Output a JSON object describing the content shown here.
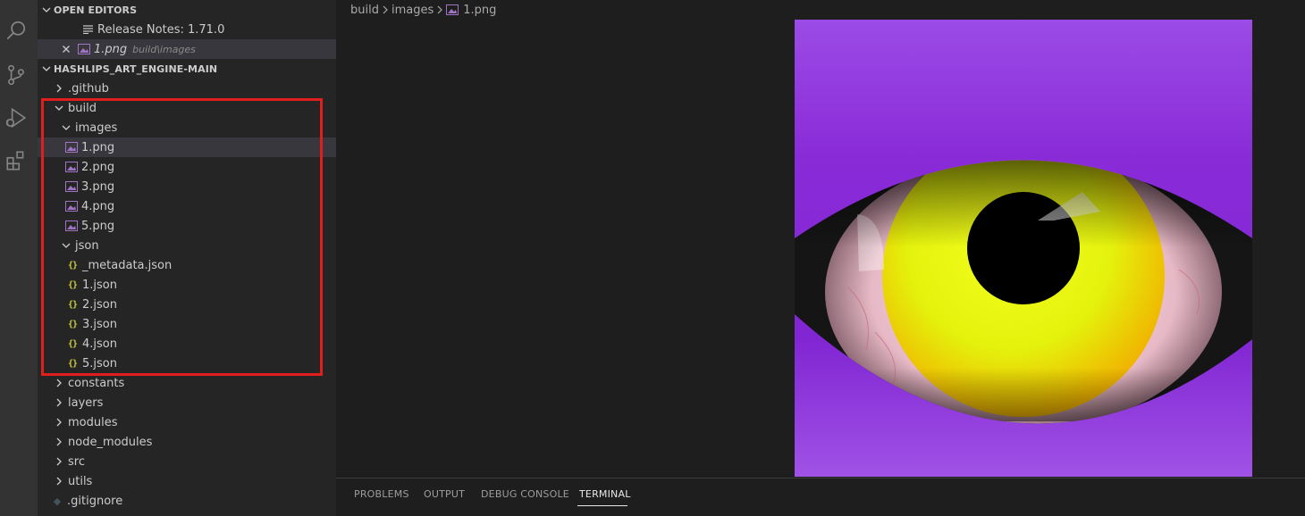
{
  "activity_bar": {
    "icons": [
      "search-icon",
      "source-control-icon",
      "run-debug-icon",
      "extensions-icon"
    ]
  },
  "sidebar": {
    "open_editors": {
      "title": "OPEN EDITORS",
      "items": [
        {
          "label": "Release Notes: 1.71.0"
        },
        {
          "label": "1.png",
          "path": "build\\images"
        }
      ]
    },
    "explorer": {
      "title": "HASHLIPS_ART_ENGINE-MAIN",
      "items": [
        {
          "label": ".github"
        },
        {
          "label": "build"
        },
        {
          "label": "images"
        },
        {
          "label": "1.png"
        },
        {
          "label": "2.png"
        },
        {
          "label": "3.png"
        },
        {
          "label": "4.png"
        },
        {
          "label": "5.png"
        },
        {
          "label": "json"
        },
        {
          "label": "_metadata.json"
        },
        {
          "label": "1.json"
        },
        {
          "label": "2.json"
        },
        {
          "label": "3.json"
        },
        {
          "label": "4.json"
        },
        {
          "label": "5.json"
        },
        {
          "label": "constants"
        },
        {
          "label": "layers"
        },
        {
          "label": "modules"
        },
        {
          "label": "node_modules"
        },
        {
          "label": "src"
        },
        {
          "label": "utils"
        },
        {
          "label": ".gitignore"
        }
      ]
    }
  },
  "editor": {
    "breadcrumb": [
      "build",
      "images",
      "1.png"
    ]
  },
  "panel": {
    "tabs": [
      "PROBLEMS",
      "OUTPUT",
      "DEBUG CONSOLE",
      "TERMINAL"
    ],
    "active_tab": "TERMINAL"
  },
  "colors": {
    "highlight_box": "#e11e1e",
    "image_background": "#9a3fe0",
    "iris": "#f2f20a",
    "json_icon": "#cbcb41",
    "image_icon": "#a074c4"
  }
}
